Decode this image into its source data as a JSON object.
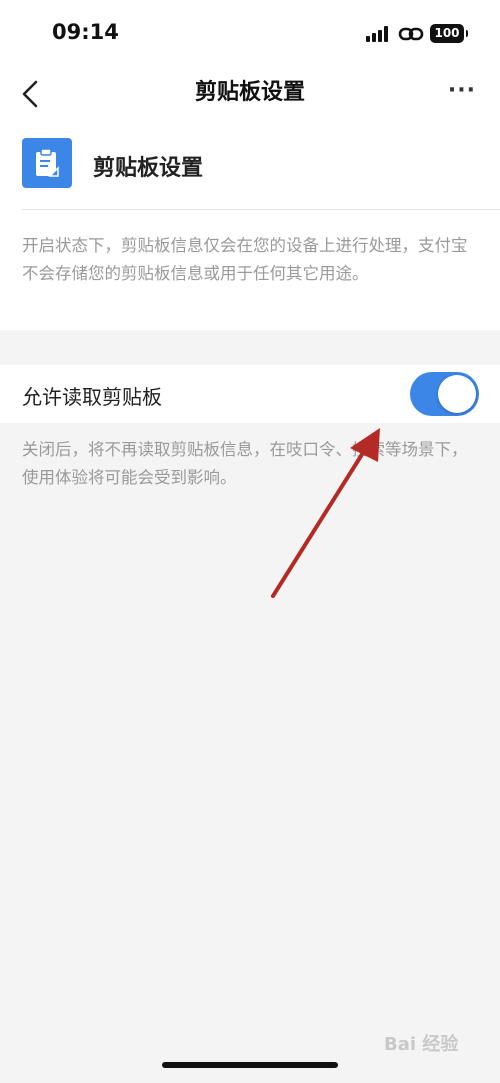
{
  "status_bar": {
    "time": "09:14",
    "battery": "100"
  },
  "nav": {
    "title": "剪贴板设置",
    "more": "···"
  },
  "header": {
    "title": "剪贴板设置",
    "icon": "clipboard-icon"
  },
  "description": "开启状态下，剪贴板信息仅会在您的设备上进行处理，支付宝不会存储您的剪贴板信息或用于任何其它用途。",
  "setting": {
    "label": "允许读取剪贴板",
    "enabled": true
  },
  "footnote": "关闭后，将不再读取剪贴板信息，在吱口令、搜索等场景下，使用体验将可能会受到影响。",
  "watermark": "Bai 经验",
  "colors": {
    "accent": "#3b86e6",
    "annotation_arrow": "#b42a24",
    "background": "#f4f4f4"
  }
}
